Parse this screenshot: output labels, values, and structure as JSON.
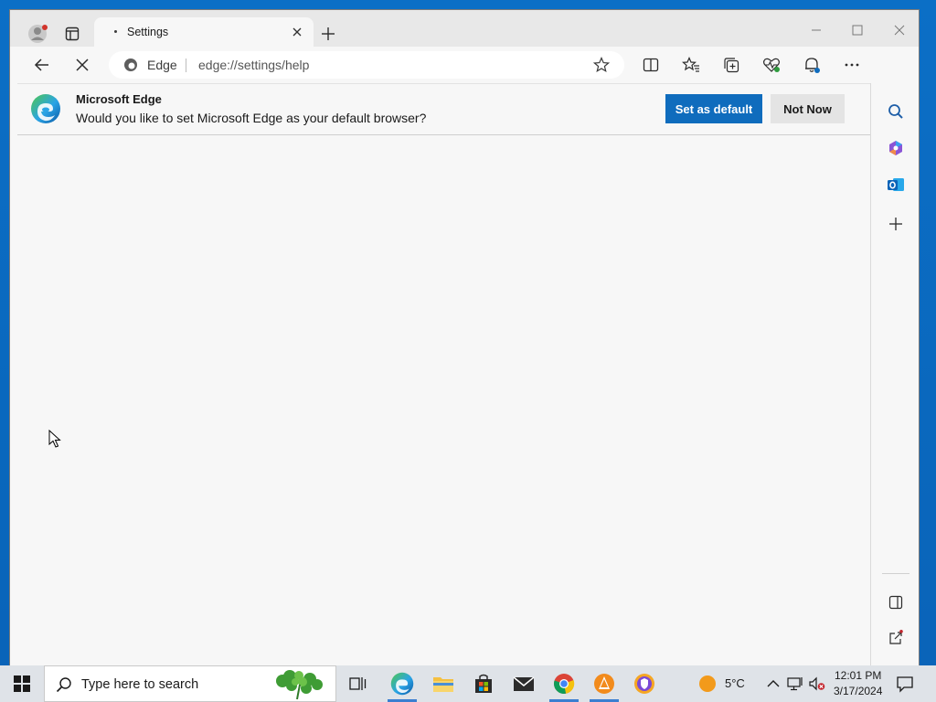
{
  "browser": {
    "tab": {
      "title": "Settings"
    },
    "address_bar": {
      "site_label": "Edge",
      "url": "edge://settings/help"
    }
  },
  "infobar": {
    "title": "Microsoft Edge",
    "message": "Would you like to set Microsoft Edge as your default browser?",
    "primary_button": "Set as default",
    "secondary_button": "Not Now"
  },
  "taskbar": {
    "search_placeholder": "Type here to search",
    "weather_temp": "5°C",
    "time": "12:01 PM",
    "date": "3/17/2024"
  },
  "colors": {
    "accent": "#0f6cbd",
    "edge_blue": "#0c59a4",
    "edge_green": "#4fc74d"
  },
  "icons": {
    "toolbar": [
      "back-icon",
      "stop-loading-icon",
      "split-screen-icon",
      "favorites-icon",
      "collections-icon",
      "browser-essentials-icon",
      "notifications-icon",
      "more-icon",
      "copilot-icon"
    ],
    "sidebar": [
      "search-icon",
      "copilot-icon",
      "outlook-icon",
      "add-icon",
      "hide-sidebar-icon",
      "external-link-icon",
      "settings-icon"
    ]
  }
}
